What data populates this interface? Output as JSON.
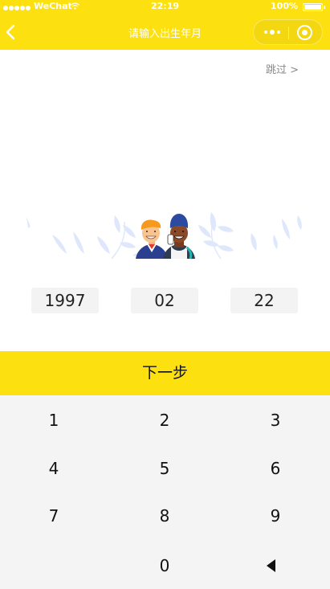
{
  "status_bar": {
    "carrier": "WeChat",
    "time": "22:19",
    "battery": "100%"
  },
  "nav": {
    "title": "请输入出生年月"
  },
  "skip_label": "跳过 >",
  "date": {
    "year": "1997",
    "month": "02",
    "day": "22"
  },
  "next_label": "下一步",
  "keypad": {
    "keys": [
      "1",
      "2",
      "3",
      "4",
      "5",
      "6",
      "7",
      "8",
      "9",
      "0"
    ]
  },
  "colors": {
    "accent": "#fde00f",
    "keypad_bg": "#f4f4f4",
    "date_box_bg": "#f3f3f3"
  },
  "icons": {
    "back": "chevron-left-icon",
    "more": "more-dots-icon",
    "close": "target-circle-icon",
    "backspace": "backspace-triangle-icon"
  }
}
